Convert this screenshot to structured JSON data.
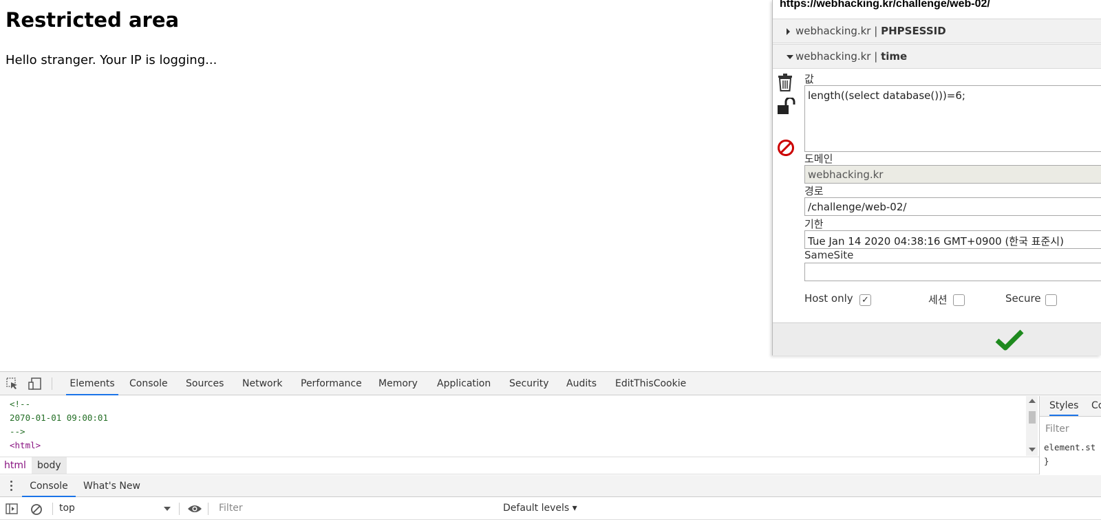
{
  "page": {
    "title": "Restricted area",
    "text": "Hello stranger. Your IP is logging..."
  },
  "cookie_editor": {
    "url": "https://webhacking.kr/challenge/web-02/",
    "cookies": [
      {
        "domain": "webhacking.kr",
        "separator": "|",
        "name": "PHPSESSID",
        "expanded": false
      },
      {
        "domain": "webhacking.kr",
        "separator": "|",
        "name": "time",
        "expanded": true
      }
    ],
    "fields": {
      "value_label": "값",
      "value": "length((select database()))=6;",
      "domain_label": "도메인",
      "domain": "webhacking.kr",
      "path_label": "경로",
      "path": "/challenge/web-02/",
      "expiry_label": "기한",
      "expiry": "Tue Jan 14 2020 04:38:16 GMT+0900 (한국 표준시)",
      "samesite_label": "SameSite",
      "samesite": ""
    },
    "checkboxes": {
      "host_only_label": "Host only",
      "host_only": true,
      "session_label": "세션",
      "session": false,
      "secure_label": "Secure",
      "secure": false
    },
    "colors": {
      "save_check": "#1e8a1e",
      "block_icon": "#cc0000"
    }
  },
  "devtools": {
    "tabs": [
      "Elements",
      "Console",
      "Sources",
      "Network",
      "Performance",
      "Memory",
      "Application",
      "Security",
      "Audits",
      "EditThisCookie"
    ],
    "active_tab": "Elements",
    "code": {
      "line1": "<!--",
      "line2": "2070-01-01 09:00:01",
      "line3": "-->",
      "line4": "<html>"
    },
    "breadcrumbs": {
      "html": "html",
      "body": "body"
    },
    "styles": {
      "tab1": "Styles",
      "tab2": "Co",
      "filter_placeholder": "Filter",
      "code1": "element.st",
      "code2": "}"
    },
    "drawer": {
      "tab_console": "Console",
      "tab_whats_new": "What's New"
    },
    "console_bar": {
      "context": "top",
      "filter_placeholder": "Filter",
      "levels": "Default levels ▾"
    }
  }
}
